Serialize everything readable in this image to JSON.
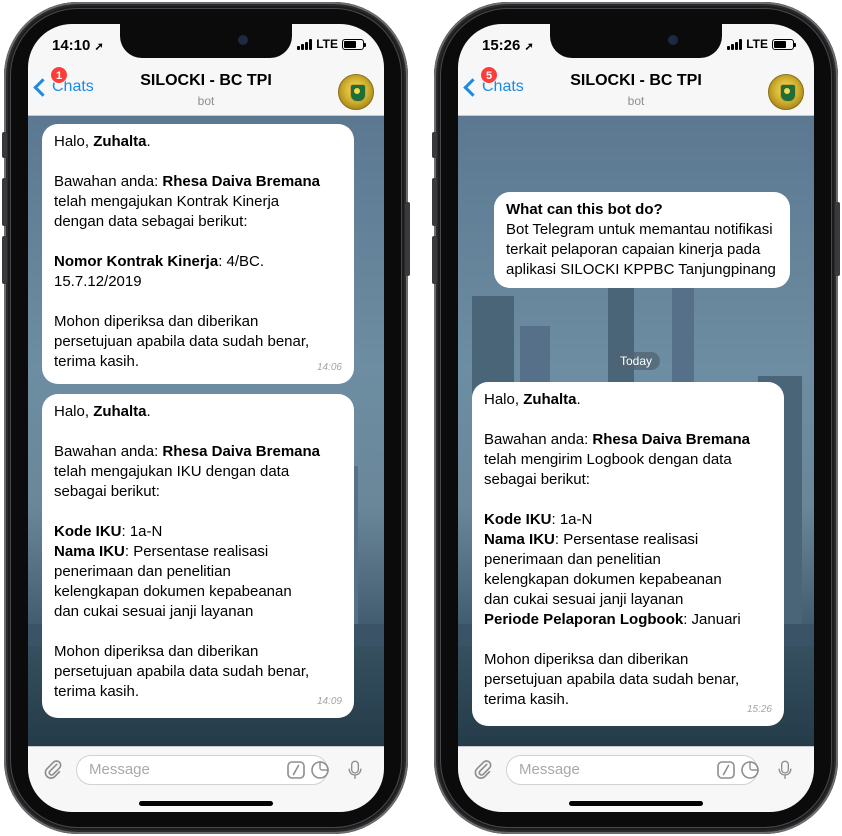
{
  "phones": [
    {
      "status": {
        "time": "14:10",
        "network": "LTE"
      },
      "header": {
        "back_label": "Chats",
        "badge": "1",
        "title": "SILOCKI - BC TPI",
        "subtitle": "bot"
      },
      "messages": [
        {
          "lines": [
            [
              {
                "t": "Halo, "
              },
              {
                "t": "Zuhalta",
                "b": true
              },
              {
                "t": "."
              }
            ],
            [],
            [
              {
                "t": "Bawahan anda: "
              },
              {
                "t": "Rhesa Daiva Bremana",
                "b": true
              }
            ],
            [
              {
                "t": "telah mengajukan Kontrak Kinerja"
              }
            ],
            [
              {
                "t": "dengan data sebagai berikut:"
              }
            ],
            [],
            [
              {
                "t": "Nomor Kontrak Kinerja",
                "b": true
              },
              {
                "t": ": 4/BC."
              }
            ],
            [
              {
                "t": "15.7.12/2019"
              }
            ],
            [],
            [
              {
                "t": "Mohon diperiksa dan diberikan"
              }
            ],
            [
              {
                "t": "persetujuan apabila data sudah benar,"
              }
            ],
            [
              {
                "t": "terima kasih."
              }
            ]
          ],
          "time": "14:06"
        },
        {
          "lines": [
            [
              {
                "t": "Halo, "
              },
              {
                "t": "Zuhalta",
                "b": true
              },
              {
                "t": "."
              }
            ],
            [],
            [
              {
                "t": "Bawahan anda: "
              },
              {
                "t": "Rhesa Daiva Bremana",
                "b": true
              }
            ],
            [
              {
                "t": "telah mengajukan IKU dengan data"
              }
            ],
            [
              {
                "t": "sebagai berikut:"
              }
            ],
            [],
            [
              {
                "t": "Kode IKU",
                "b": true
              },
              {
                "t": ": 1a-N"
              }
            ],
            [
              {
                "t": "Nama IKU",
                "b": true
              },
              {
                "t": ": Persentase realisasi"
              }
            ],
            [
              {
                "t": "penerimaan dan penelitian"
              }
            ],
            [
              {
                "t": "kelengkapan dokumen kepabeanan"
              }
            ],
            [
              {
                "t": "dan cukai sesuai janji layanan"
              }
            ],
            [],
            [
              {
                "t": "Mohon diperiksa dan diberikan"
              }
            ],
            [
              {
                "t": "persetujuan apabila data sudah benar,"
              }
            ],
            [
              {
                "t": "terima kasih."
              }
            ]
          ],
          "time": "14:09"
        }
      ],
      "composer": {
        "placeholder": "Message"
      }
    },
    {
      "status": {
        "time": "15:26",
        "network": "LTE"
      },
      "header": {
        "back_label": "Chats",
        "badge": "5",
        "title": "SILOCKI - BC TPI",
        "subtitle": "bot"
      },
      "info": {
        "heading": "What can this bot do?",
        "lines": [
          "Bot Telegram untuk memantau notifikasi",
          "terkait pelaporan capaian kinerja pada",
          "aplikasi SILOCKI KPPBC Tanjungpinang"
        ]
      },
      "date_divider": "Today",
      "messages": [
        {
          "lines": [
            [
              {
                "t": "Halo, "
              },
              {
                "t": "Zuhalta",
                "b": true
              },
              {
                "t": "."
              }
            ],
            [],
            [
              {
                "t": "Bawahan anda: "
              },
              {
                "t": "Rhesa Daiva Bremana",
                "b": true
              }
            ],
            [
              {
                "t": "telah mengirim Logbook dengan data"
              }
            ],
            [
              {
                "t": "sebagai berikut:"
              }
            ],
            [],
            [
              {
                "t": "Kode IKU",
                "b": true
              },
              {
                "t": ": 1a-N"
              }
            ],
            [
              {
                "t": "Nama IKU",
                "b": true
              },
              {
                "t": ": Persentase realisasi"
              }
            ],
            [
              {
                "t": "penerimaan dan penelitian"
              }
            ],
            [
              {
                "t": "kelengkapan dokumen kepabeanan"
              }
            ],
            [
              {
                "t": "dan cukai sesuai janji layanan"
              }
            ],
            [
              {
                "t": "Periode Pelaporan Logbook",
                "b": true
              },
              {
                "t": ": Januari"
              }
            ],
            [],
            [
              {
                "t": "Mohon diperiksa dan diberikan"
              }
            ],
            [
              {
                "t": "persetujuan apabila data sudah benar,"
              }
            ],
            [
              {
                "t": "terima kasih."
              }
            ]
          ],
          "time": "15:26"
        }
      ],
      "composer": {
        "placeholder": "Message"
      }
    }
  ],
  "colors": {
    "accent": "#1a8ae5",
    "badge": "#fc3d39",
    "bubble": "#ffffff",
    "chat_bg": "#5b7890"
  }
}
